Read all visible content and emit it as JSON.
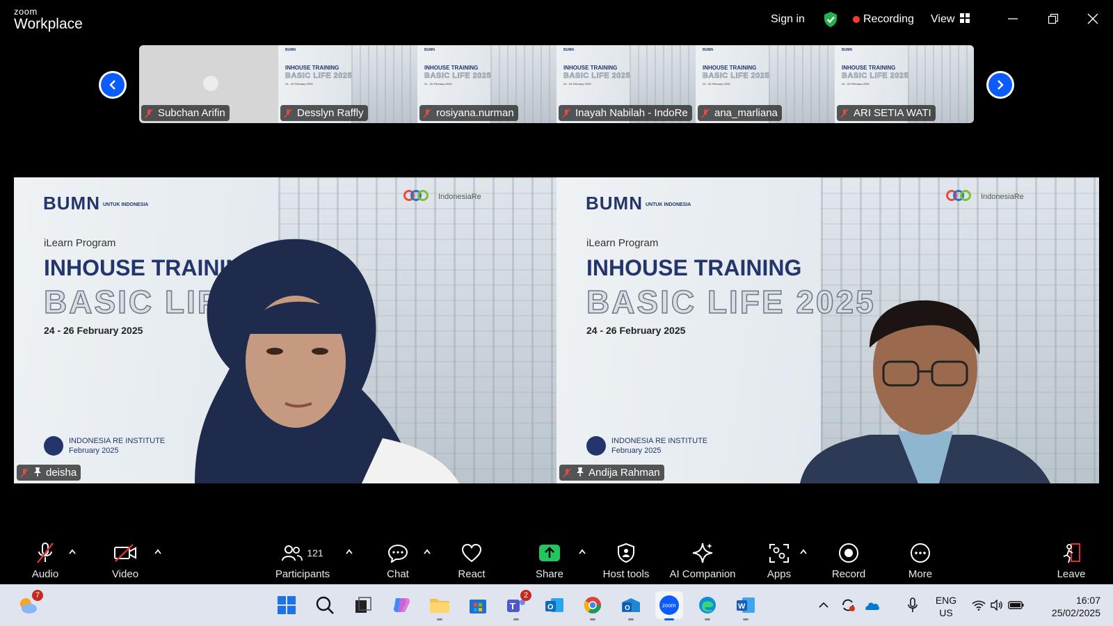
{
  "titlebar": {
    "logo_small": "zoom",
    "logo_main": "Workplace",
    "sign_in": "Sign in",
    "recording": "Recording",
    "view": "View",
    "colors": {
      "recording_dot": "#ff3b30",
      "shield": "#22b14c"
    }
  },
  "gallery_strip": {
    "participants": [
      {
        "name": "Subchan Arifin",
        "muted": true,
        "video": "blank"
      },
      {
        "name": "Desslyn Raffly",
        "muted": true,
        "video": "slide"
      },
      {
        "name": "rosiyana.nurman",
        "muted": true,
        "video": "slide"
      },
      {
        "name": "Inayah Nabilah - IndoRe",
        "muted": true,
        "video": "slide"
      },
      {
        "name": "ana_marliana",
        "muted": true,
        "video": "slide"
      },
      {
        "name": "ARI SETIA WATI",
        "muted": true,
        "video": "slide"
      }
    ],
    "prev_icon": "chevron-left-icon",
    "next_icon": "chevron-right-icon"
  },
  "slide": {
    "bumn": "BUMN",
    "bumn_sub": "UNTUK INDONESIA",
    "program": "iLearn Program",
    "title": "INHOUSE TRAINING",
    "subtitle": "BASIC LIFE 2025",
    "dates": "24 - 26 February 2025",
    "institute": "INDONESIA RE INSTITUTE",
    "month": "February 2025",
    "logo1": "IndonesiaRe",
    "logo2": "IndonesiaRe"
  },
  "main_tiles": [
    {
      "name": "deisha",
      "muted": true,
      "pinned": true
    },
    {
      "name": "Andija Rahman",
      "muted": true,
      "pinned": true
    }
  ],
  "toolbar": {
    "audio": "Audio",
    "video": "Video",
    "participants": "Participants",
    "participants_count": "121",
    "chat": "Chat",
    "react": "React",
    "share": "Share",
    "host_tools": "Host tools",
    "ai_companion": "AI Companion",
    "apps": "Apps",
    "record": "Record",
    "more": "More",
    "leave": "Leave",
    "colors": {
      "share": "#22c55e",
      "leave": "#e02f2f"
    }
  },
  "taskbar": {
    "weather_badge": "7",
    "teams_badge": "2",
    "lang_top": "ENG",
    "lang_bottom": "US",
    "time": "16:07",
    "date": "25/02/2025"
  }
}
